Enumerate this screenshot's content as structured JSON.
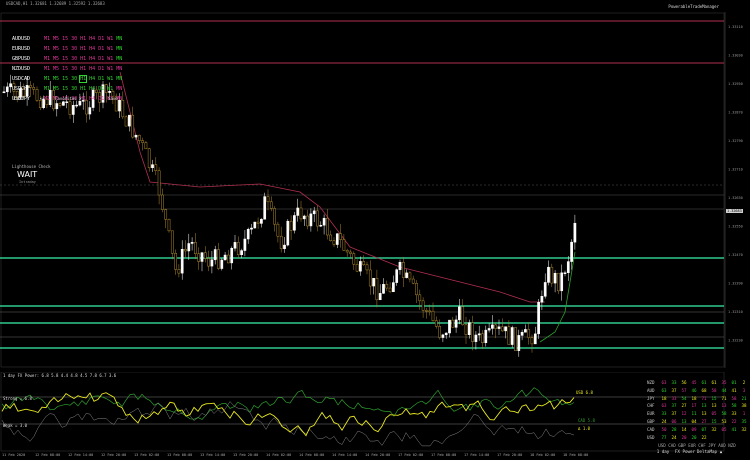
{
  "window_title": "USDCAD,H1 1.32681 1.32689 1.32592 1.32683",
  "brand": "PowerableTradeManager",
  "pair_list": [
    {
      "name": "AUDUSD",
      "tfs": [
        "M1",
        "M5",
        "15",
        "30",
        "H1",
        "H4",
        "D1",
        "W1",
        "MN"
      ],
      "colors": [
        "#e0359a",
        "#e0359a",
        "#e0359a",
        "#e0359a",
        "#e0359a",
        "#e0359a",
        "#e0359a",
        "#e0359a",
        "#2ed52e"
      ],
      "boxed": -1
    },
    {
      "name": "EURUSD",
      "tfs": [
        "M1",
        "M5",
        "15",
        "30",
        "H1",
        "H4",
        "D1",
        "W1",
        "MN"
      ],
      "colors": [
        "#e0359a",
        "#e0359a",
        "#e0359a",
        "#e0359a",
        "#e0359a",
        "#e0359a",
        "#e0359a",
        "#e0359a",
        "#2ed52e"
      ],
      "boxed": -1
    },
    {
      "name": "GBPUSD",
      "tfs": [
        "M1",
        "M5",
        "15",
        "30",
        "H1",
        "H4",
        "D1",
        "W1",
        "MN"
      ],
      "colors": [
        "#e0359a",
        "#e0359a",
        "#e0359a",
        "#e0359a",
        "#e0359a",
        "#e0359a",
        "#e0359a",
        "#e0359a",
        "#2ed52e"
      ],
      "boxed": -1
    },
    {
      "name": "NZDUSD",
      "tfs": [
        "M1",
        "M5",
        "15",
        "30",
        "H1",
        "H4",
        "D1",
        "W1",
        "MN"
      ],
      "colors": [
        "#e0359a",
        "#e0359a",
        "#e0359a",
        "#e0359a",
        "#e0359a",
        "#e0359a",
        "#e0359a",
        "#e0359a",
        "#e0359a"
      ],
      "boxed": -1
    },
    {
      "name": "USDCAD",
      "tfs": [
        "M1",
        "M5",
        "15",
        "30",
        "H1",
        "H4",
        "D1",
        "W1",
        "MN"
      ],
      "colors": [
        "#2ed52e",
        "#2ed52e",
        "#2ed52e",
        "#2ed52e",
        "#2ed52e",
        "#2ed52e",
        "#2ed52e",
        "#2ed52e",
        "#2ed52e"
      ],
      "boxed": 4
    },
    {
      "name": "USDCHF",
      "tfs": [
        "M1",
        "M5",
        "15",
        "30",
        "H1",
        "H4",
        "D1",
        "W1",
        "MN"
      ],
      "colors": [
        "#2ed52e",
        "#2ed52e",
        "#2ed52e",
        "#2ed52e",
        "#2ed52e",
        "#2ed52e",
        "#2ed52e",
        "#2ed52e",
        "#e0359a"
      ],
      "boxed": -1
    },
    {
      "name": "USDJPY",
      "tfs": [
        "M1",
        "M5",
        "15",
        "30",
        "H1",
        "H4",
        "D1",
        "W1",
        "MN"
      ],
      "colors": [
        "#e0359a",
        "#e0359a",
        "#e0359a",
        "#e0359a",
        "#e0359a",
        "#e0359a",
        "#e0359a",
        "#e0359a",
        "#e0359a"
      ],
      "boxed": -1
    }
  ],
  "nav": {
    "load": "Load",
    "favorites": "Favorites",
    "save": "Save",
    "prev": "<",
    "next": ">"
  },
  "lighthouse": {
    "title": "Lighthouse Check",
    "status": "WAIT",
    "sub": "Intraday"
  },
  "price_axis": [
    "1.33110",
    "1.33030",
    "1.32950",
    "1.32870",
    "1.32790",
    "1.32710",
    "1.32630",
    "1.32550",
    "1.32470",
    "1.32390",
    "1.32310",
    "1.32230"
  ],
  "current_price": "1.32683",
  "time_axis": [
    "11 Feb 2020",
    "12 Feb 08:00",
    "12 Feb 14:00",
    "12 Feb 20:00",
    "13 Feb 02:00",
    "13 Feb 08:00",
    "13 Feb 14:00",
    "13 Feb 20:00",
    "14 Feb 02:00",
    "14 Feb 08:00",
    "14 Feb 14:00",
    "14 Feb 20:00",
    "17 Feb 02:00",
    "17 Feb 08:00",
    "17 Feb 14:00",
    "17 Feb 20:00",
    "18 Feb 02:00",
    "18 Feb 08:00"
  ],
  "fx_power": {
    "header": "1 day FX Power: 6.8 5.8 4.4 4.8 4.5 7.8 6.7 3.6",
    "strong": "Strong = 6.8",
    "weak": "Weak = 3.0",
    "usd_label": "USD 6.8",
    "cad_label": "CAD 5.8",
    "val_label": "Δ 1.0"
  },
  "matrix": {
    "rows": [
      {
        "label": "NZD",
        "cells": [
          "63",
          "33",
          "56",
          "45",
          "61",
          "61",
          "35",
          "01",
          "2"
        ]
      },
      {
        "label": "AUD",
        "cells": [
          "63",
          "37",
          "57",
          "46",
          "68",
          "58",
          "44",
          "41",
          "3"
        ]
      },
      {
        "label": "JPY",
        "cells": [
          "18",
          "33",
          "54",
          "18",
          "71",
          "15",
          "71",
          "58",
          "21"
        ]
      },
      {
        "label": "CHF",
        "cells": [
          "63",
          "37",
          "27",
          "17",
          "13",
          "13",
          "13",
          "58",
          "38"
        ]
      },
      {
        "label": "EUR",
        "cells": [
          "33",
          "37",
          "12",
          "11",
          "13",
          "05",
          "58",
          "33",
          "1"
        ]
      },
      {
        "label": "GBP",
        "cells": [
          "24",
          "06",
          "13",
          "04",
          "27",
          "15",
          "53",
          "22",
          "35"
        ]
      },
      {
        "label": "CAD",
        "cells": [
          "50",
          "28",
          "14",
          "09",
          "07",
          "32",
          "05",
          "41",
          "32"
        ]
      },
      {
        "label": "USD",
        "cells": [
          "77",
          "24",
          "20",
          "20",
          "22",
          "",
          "",
          "",
          ""
        ]
      }
    ],
    "col_header": [
      "USD",
      "CAD",
      "GBP",
      "EUR",
      "CHF",
      "JPY",
      "AUD",
      "NZD"
    ],
    "footer": [
      "1 day",
      "FX Power",
      "DeltaMap",
      "▲"
    ]
  },
  "colors": {
    "bull": "#ffffff",
    "bear": "#b08a2e",
    "support": "#2fc98c",
    "resistance": "#b03050",
    "yellow": "#e8e820",
    "green": "#2ea02e",
    "grey": "#888888"
  }
}
